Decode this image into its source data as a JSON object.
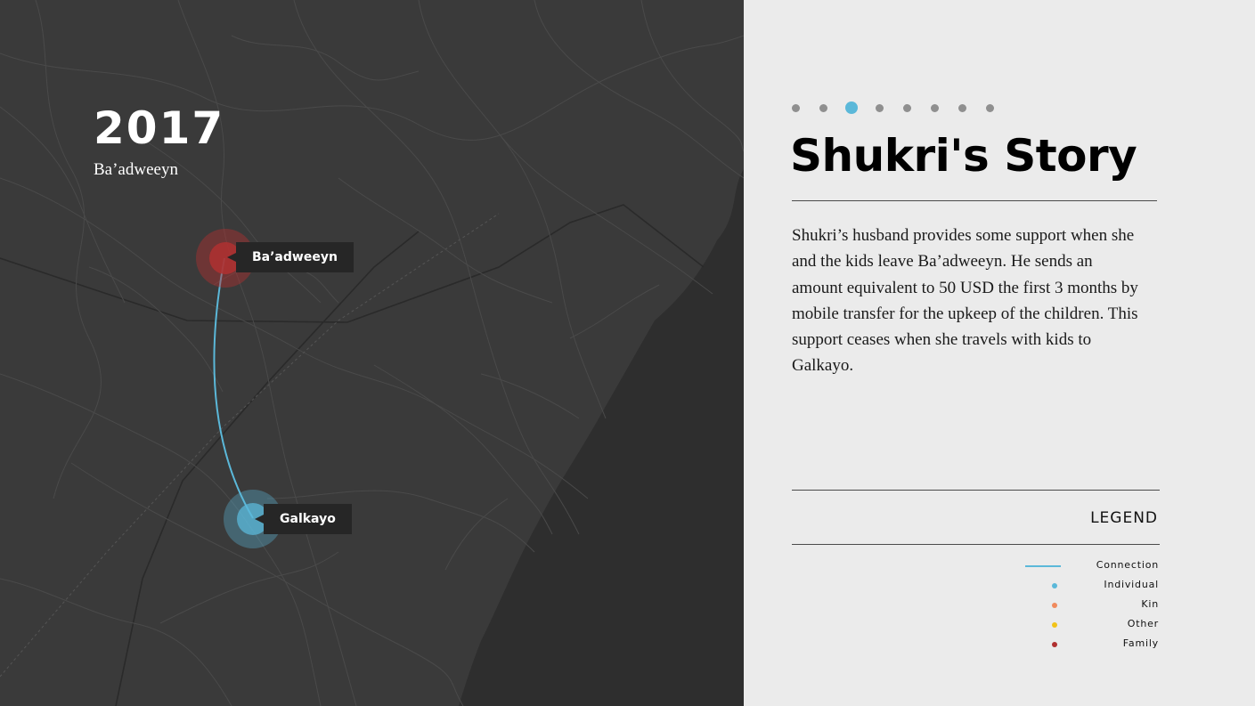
{
  "map": {
    "year": "2017",
    "location": "Ba’adweeyn",
    "places": [
      {
        "name": "Ba’adweeyn",
        "type": "family"
      },
      {
        "name": "Galkayo",
        "type": "individual"
      }
    ],
    "connection_color": "#5bb8d9"
  },
  "panel": {
    "title": "Shukri's Story",
    "story": "Shukri’s husband provides some support when she and the kids leave Ba’adweeyn. He sends an amount equivalent to 50 USD the first 3 months by mobile transfer for the upkeep of the children. This support ceases when she travels with kids to Galkayo.",
    "slides_total": 8,
    "slide_active_index": 2
  },
  "legend": {
    "title": "LEGEND",
    "items": [
      {
        "label": "Connection",
        "symbol": "line",
        "color": "#5bb8d9"
      },
      {
        "label": "Individual",
        "symbol": "dot",
        "color": "#5bb8d9"
      },
      {
        "label": "Kin",
        "symbol": "dot",
        "color": "#f08a5d"
      },
      {
        "label": "Other",
        "symbol": "dot",
        "color": "#f2c318"
      },
      {
        "label": "Family",
        "symbol": "dot",
        "color": "#b03030"
      }
    ]
  },
  "colors": {
    "map_land": "#3a3a3a",
    "map_sea": "#2e2e2e",
    "panel_bg": "#ebebeb",
    "family_marker": "#b03030",
    "individual_marker": "#5bb8d9"
  }
}
